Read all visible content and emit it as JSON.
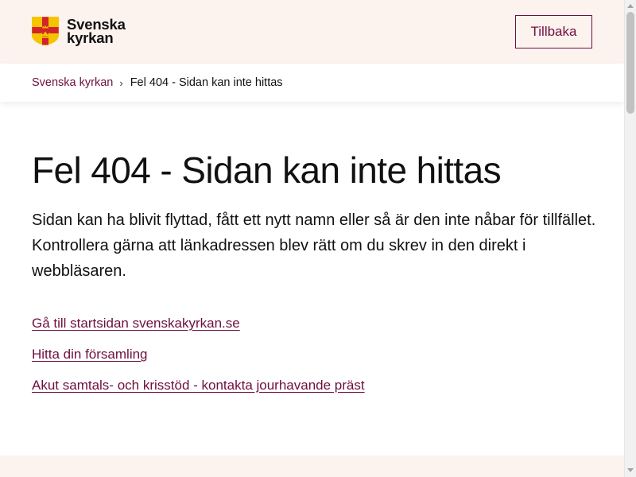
{
  "header": {
    "logo": {
      "line1": "Svenska",
      "line2": "kyrkan",
      "icon": "church-shield-icon",
      "colors": {
        "shield": "#f5c400",
        "cross": "#d2232a",
        "crowns": "#f5c400"
      }
    },
    "back_button_label": "Tillbaka"
  },
  "breadcrumb": {
    "home_label": "Svenska kyrkan",
    "separator": "›",
    "current_label": "Fel 404 - Sidan kan inte hittas"
  },
  "main": {
    "title": "Fel 404 - Sidan kan inte hittas",
    "intro": "Sidan kan ha blivit flyttad, fått ett nytt namn eller så är den inte nåbar för tillfället. Kontrollera gärna att länkadressen blev rätt om du skrev in den direkt i webbläsaren.",
    "links": [
      {
        "label": "Gå till startsidan svenskakyrkan.se"
      },
      {
        "label": "Hitta din församling"
      },
      {
        "label": "Akut samtals- och krisstöd - kontakta jourhavande präst"
      }
    ]
  },
  "colors": {
    "header_background": "#fcf2ee",
    "accent": "#6e0f3f",
    "text": "#111111"
  }
}
